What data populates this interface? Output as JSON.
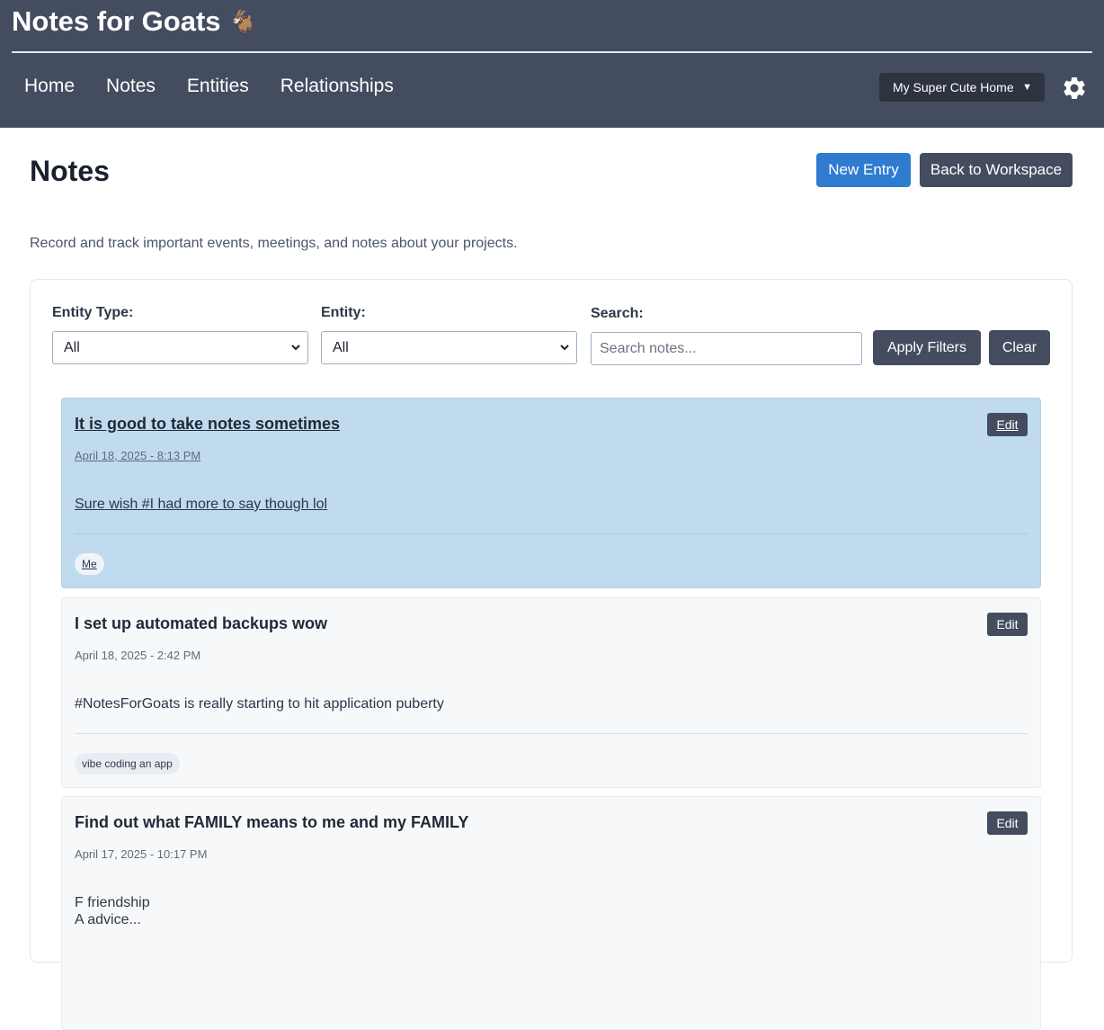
{
  "app": {
    "title": "Notes for Goats",
    "title_emoji": "🐐"
  },
  "nav": {
    "items": [
      "Home",
      "Notes",
      "Entities",
      "Relationships"
    ]
  },
  "workspace": {
    "selected": "My Super Cute Home",
    "caret": "▼"
  },
  "page": {
    "title": "Notes",
    "new_entry_label": "New Entry",
    "back_label": "Back to Workspace",
    "description": "Record and track important events, meetings, and notes about your projects."
  },
  "filters": {
    "entity_type_label": "Entity Type:",
    "entity_type_value": "All",
    "entity_label": "Entity:",
    "entity_value": "All",
    "search_label": "Search:",
    "search_placeholder": "Search notes...",
    "search_value": "",
    "apply_label": "Apply Filters",
    "clear_label": "Clear"
  },
  "notes": [
    {
      "title": "It is good to take notes sometimes",
      "date": "April 18, 2025 - 8:13 PM",
      "body": "Sure wish #I had more to say though lol",
      "tags": [
        "Me"
      ],
      "edit_label": "Edit",
      "active": true
    },
    {
      "title": "I set up automated backups wow",
      "date": "April 18, 2025 - 2:42 PM",
      "body": "#NotesForGoats is really starting to hit application puberty",
      "tags": [
        "vibe coding an app"
      ],
      "edit_label": "Edit",
      "active": false
    },
    {
      "title": "Find out what FAMILY means to me and my FAMILY",
      "date": "April 17, 2025 - 10:17 PM",
      "body_lines": [
        "F friendship",
        "A advice..."
      ],
      "edit_label": "Edit",
      "active": false
    }
  ],
  "colors": {
    "header_bg": "#444d5f",
    "primary_button": "#2f7bd0",
    "secondary_button": "#444d5f",
    "active_note_bg": "#c0dbed"
  }
}
